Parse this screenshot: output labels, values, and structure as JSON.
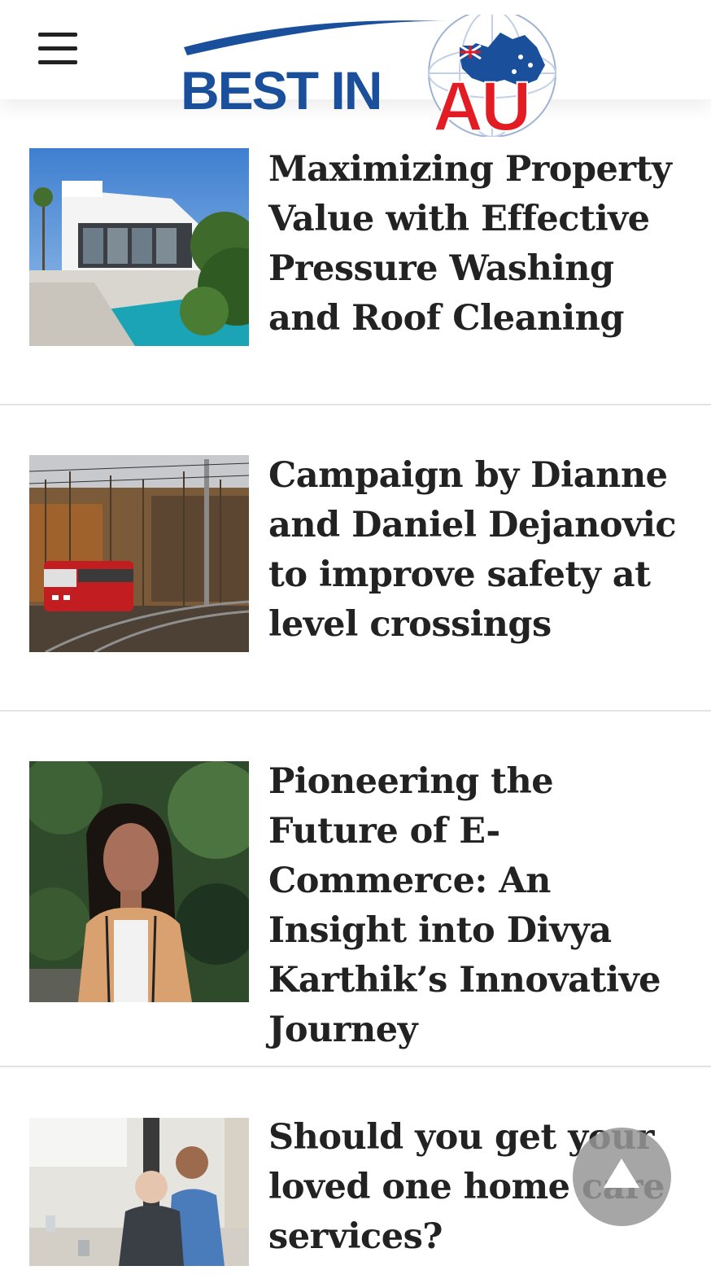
{
  "header": {
    "menu_icon": "hamburger-menu-icon",
    "logo": {
      "text_left": "BEST IN",
      "text_right": "AU",
      "blue": "#1a4f9c",
      "red": "#e31b23"
    }
  },
  "articles": [
    {
      "title": "Maximizing Property Value with Effective Pressure Washing and Roof Cleaning",
      "image": "modern-white-house-pool"
    },
    {
      "title": "Campaign by Dianne and Daniel Dejanovic to improve safety at level crossings",
      "image": "red-train-autumn-forest"
    },
    {
      "title": "Pioneering the Future of E-Commerce: An Insight into Divya Karthik’s Innovative Journey",
      "image": "woman-portrait-greenery"
    },
    {
      "title": "Should you get your loved one home care services?",
      "image": "caregiver-with-elderly-man"
    }
  ],
  "scroll_top": {
    "icon": "arrow-up-icon"
  }
}
